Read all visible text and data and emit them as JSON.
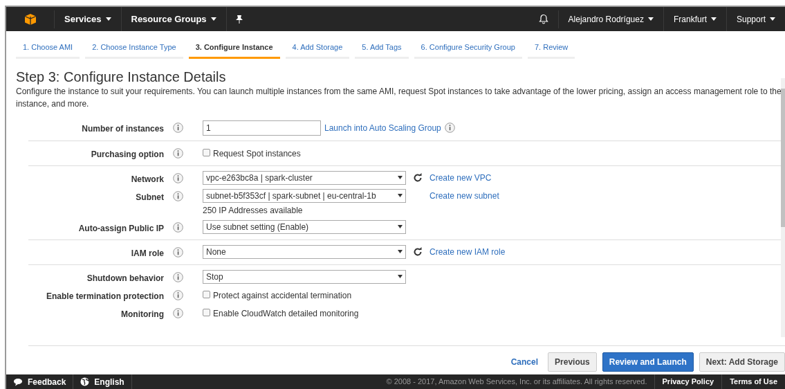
{
  "nav": {
    "left": [
      {
        "label": "Services"
      },
      {
        "label": "Resource Groups"
      }
    ],
    "right": [
      {
        "label": "Alejandro Rodríguez"
      },
      {
        "label": "Frankfurt"
      },
      {
        "label": "Support"
      }
    ]
  },
  "steps": [
    {
      "label": "1. Choose AMI",
      "selected": false
    },
    {
      "label": "2. Choose Instance Type",
      "selected": false
    },
    {
      "label": "3. Configure Instance",
      "selected": true
    },
    {
      "label": "4. Add Storage",
      "selected": false
    },
    {
      "label": "5. Add Tags",
      "selected": false
    },
    {
      "label": "6. Configure Security Group",
      "selected": false
    },
    {
      "label": "7. Review",
      "selected": false
    }
  ],
  "heading": "Step 3: Configure Instance Details",
  "description": "Configure the instance to suit your requirements. You can launch multiple instances from the same AMI, request Spot instances to take advantage of the lower pricing, assign an access management role to the instance, and more.",
  "form": {
    "sections": [
      [
        {
          "label": "Number of instances",
          "kind": "text",
          "value": "1",
          "link": "Launch into Auto Scaling Group",
          "link_info": true
        }
      ],
      [
        {
          "label": "Purchasing option",
          "kind": "checkbox",
          "value": "Request Spot instances",
          "checked": false
        }
      ],
      [
        {
          "label": "Network",
          "kind": "select",
          "value": "vpc-e263bc8a | spark-cluster",
          "refresh": true,
          "link": "Create new VPC"
        },
        {
          "label": "Subnet",
          "kind": "select",
          "value": "subnet-b5f353cf | spark-subnet | eu-central-1b",
          "refresh": false,
          "link": "Create new subnet",
          "note": "250 IP Addresses available"
        },
        {
          "label": "Auto-assign Public IP",
          "kind": "select",
          "value": "Use subnet setting (Enable)"
        }
      ],
      [
        {
          "label": "IAM role",
          "kind": "select",
          "value": "None",
          "refresh": true,
          "link": "Create new IAM role"
        }
      ],
      [
        {
          "label": "Shutdown behavior",
          "kind": "select",
          "value": "Stop"
        },
        {
          "label": "Enable termination protection",
          "kind": "checkbox",
          "value": "Protect against accidental termination",
          "checked": false
        },
        {
          "label": "Monitoring",
          "kind": "checkbox",
          "value": "Enable CloudWatch detailed monitoring",
          "checked": false
        }
      ]
    ]
  },
  "buttons": [
    {
      "label": "Cancel",
      "kind": "link"
    },
    {
      "label": "Previous",
      "kind": "secondary"
    },
    {
      "label": "Review and Launch",
      "kind": "primary"
    },
    {
      "label": "Next: Add Storage",
      "kind": "secondary"
    }
  ],
  "footer": {
    "left": [
      {
        "label": "Feedback"
      },
      {
        "label": "English"
      }
    ],
    "copyright": "© 2008 - 2017, Amazon Web Services, Inc. or its affiliates. All rights reserved.",
    "links": [
      "Privacy Policy",
      "Terms of Use"
    ]
  }
}
